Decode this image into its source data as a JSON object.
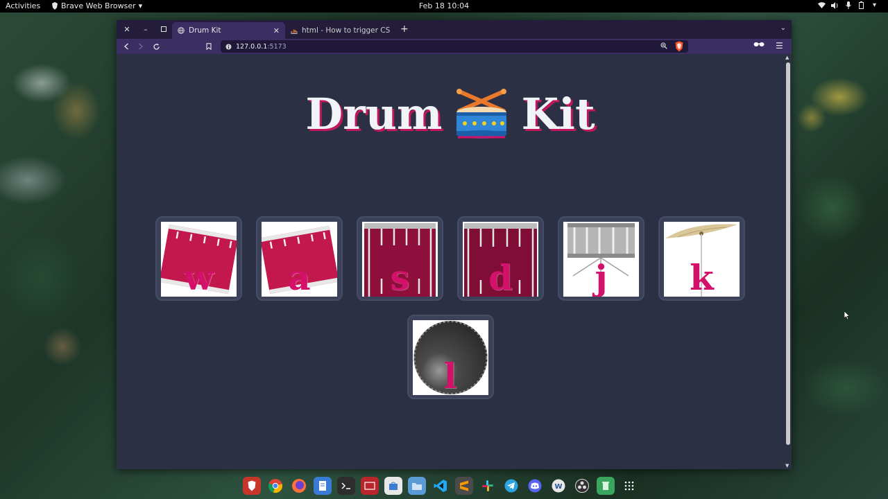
{
  "topbar": {
    "activities": "Activities",
    "app_menu": "Brave Web Browser",
    "clock": "Feb 18  10:04"
  },
  "browser": {
    "tabs": [
      {
        "title": "Drum Kit",
        "active": true
      },
      {
        "title": "html - How to trigger CSS \"ho",
        "active": false
      }
    ],
    "url": {
      "host": "127.0.0.1",
      "port": ":5173"
    }
  },
  "page": {
    "title_left": "Drum",
    "title_right": "Kit",
    "keys": [
      {
        "letter": "w",
        "sound": "tom-1"
      },
      {
        "letter": "a",
        "sound": "tom-2"
      },
      {
        "letter": "s",
        "sound": "tom-3"
      },
      {
        "letter": "d",
        "sound": "tom-4"
      },
      {
        "letter": "j",
        "sound": "snare"
      },
      {
        "letter": "k",
        "sound": "crash"
      },
      {
        "letter": "l",
        "sound": "kick-bass"
      }
    ]
  },
  "colors": {
    "page_bg": "#2b3044",
    "accent": "#d4116a",
    "title": "#f0f3f7",
    "browser_chrome": "#3a2e63"
  },
  "dock": {
    "apps": [
      "brave",
      "chrome",
      "firefox",
      "files-doc",
      "terminal",
      "screenshot",
      "store",
      "files",
      "vscode",
      "sublime",
      "slack",
      "telegram",
      "discord",
      "ms-edge",
      "obs",
      "trash",
      "app-grid"
    ]
  }
}
